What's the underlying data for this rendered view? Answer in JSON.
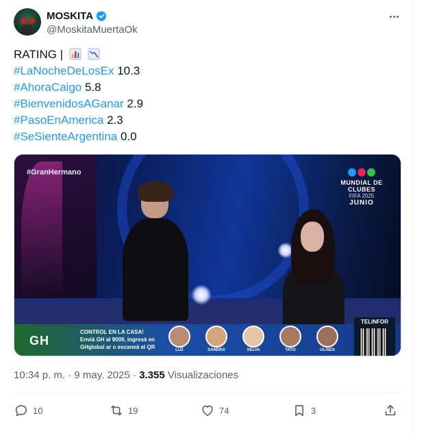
{
  "author": {
    "name": "MOSKITA",
    "handle": "@MoskitaMuertaOk",
    "verified": true
  },
  "tweet": {
    "lines": [
      {
        "hashtag": "",
        "text": "RATING |"
      },
      {
        "hashtag": "#LaNocheDeLosEx",
        "text": " 10.3"
      },
      {
        "hashtag": "#AhoraCaigo",
        "text": " 5.8"
      },
      {
        "hashtag": "#BienvenidosAGanar",
        "text": " 2.9"
      },
      {
        "hashtag": "#PasoEnAmerica",
        "text": " 2.3"
      },
      {
        "hashtag": "#SeSienteArgentina",
        "text": " 0.0"
      }
    ],
    "emoji": [
      "bar-chart-emoji",
      "chart-decreasing-emoji"
    ]
  },
  "media": {
    "overlay_tag": "#GranHermano",
    "logo_line1": "MUNDIAL DE CLUBES",
    "logo_line2": "FIFA 2025",
    "logo_line3": "JUNIO",
    "gh_logo": "GH",
    "promo_line1": "CONTROL EN LA CASA!",
    "promo_line2": "Enviá GH al 9009, ingresá en",
    "promo_line3": "GHglobal ar o escaneá el QR",
    "contestants": [
      "LUZ",
      "SANDRA",
      "SELVA",
      "TATO",
      "ULISES"
    ],
    "sponsor": "TELINFOR"
  },
  "meta": {
    "time": "10:34 p. m.",
    "separator": " · ",
    "date": "9 may. 2025",
    "views_count": "3.355",
    "views_label": " Visualizaciones"
  },
  "actions": {
    "replies": "10",
    "retweets": "19",
    "likes": "74",
    "bookmarks": "3"
  },
  "colors": {
    "link": "#1d9bf0",
    "secondary": "#536471",
    "primary": "#0f1419"
  }
}
